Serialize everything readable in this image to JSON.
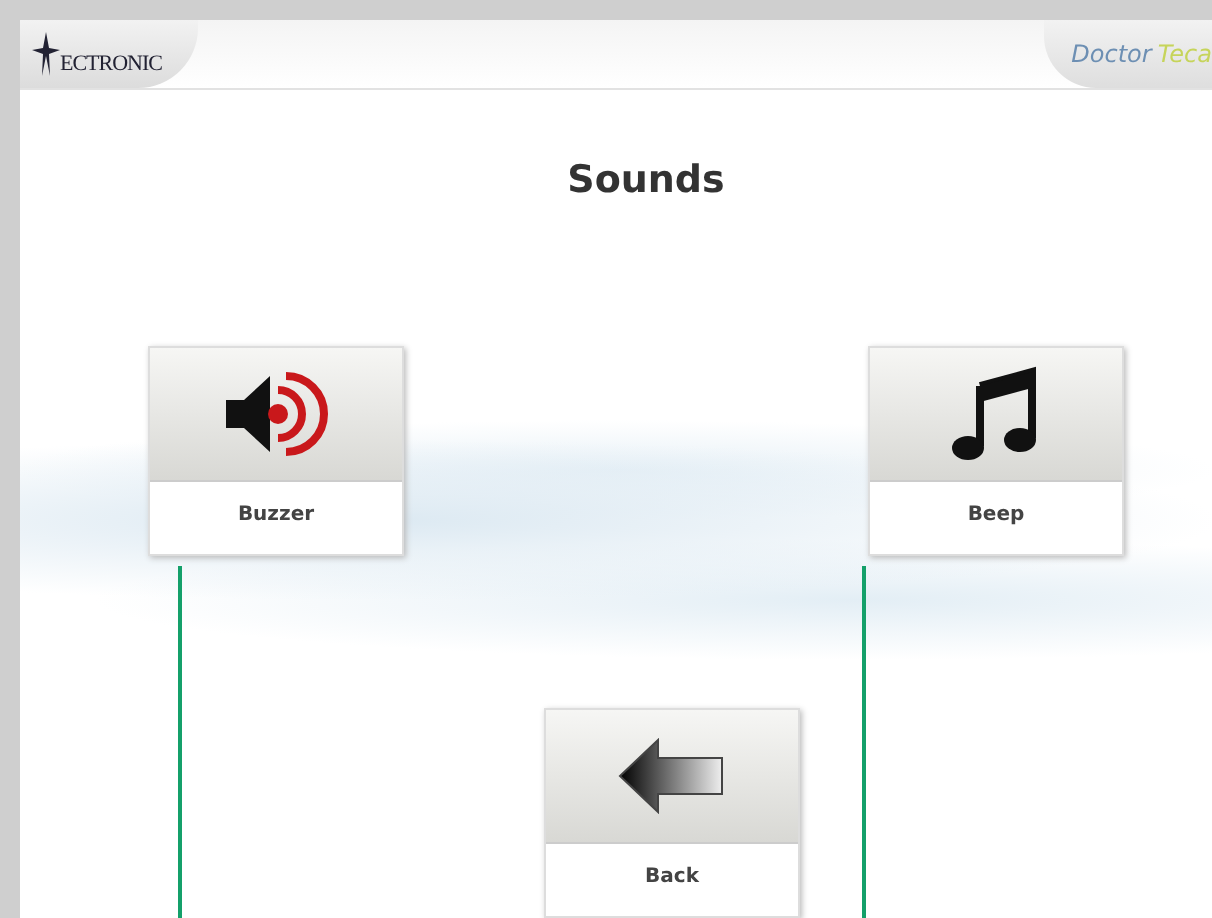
{
  "header": {
    "logo_text": "ECTRONIC",
    "brand_first": "Doctor",
    "brand_second": "Teca"
  },
  "title": "Sounds",
  "buttons": [
    {
      "kind": "speaker",
      "label": "Buzzer"
    },
    {
      "kind": "note",
      "label": "Beep"
    },
    {
      "kind": "back",
      "label": "Back"
    }
  ]
}
